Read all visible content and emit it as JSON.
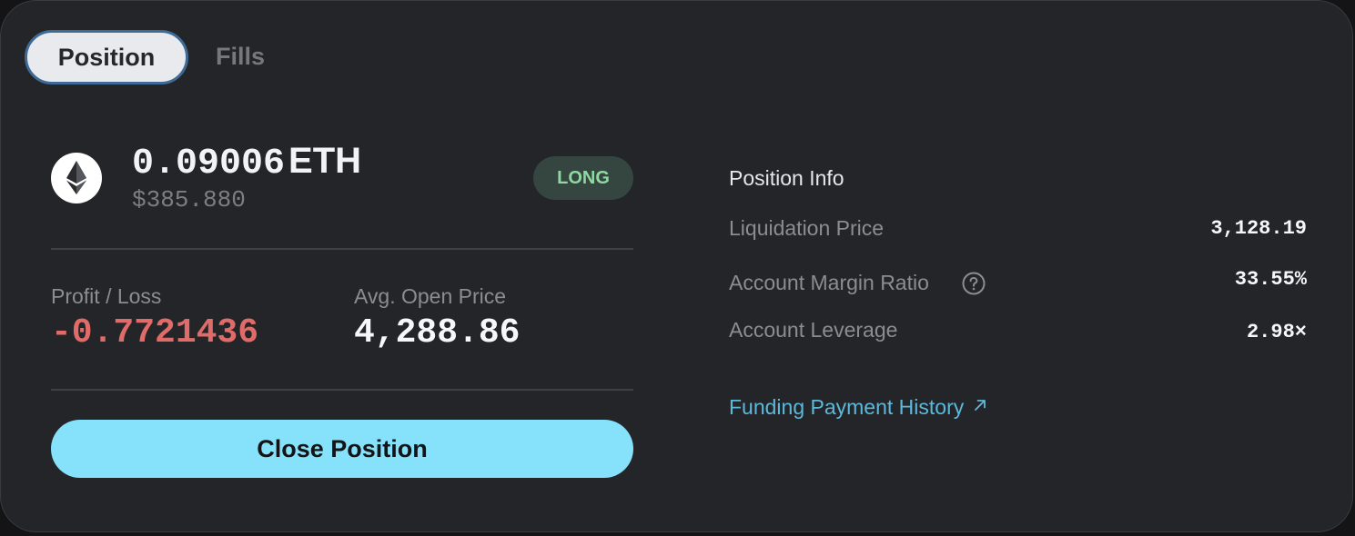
{
  "tabs": {
    "position_label": "Position",
    "fills_label": "Fills",
    "active": "Position"
  },
  "position": {
    "asset_icon": "ethereum-icon",
    "amount": "0.09006",
    "unit": "ETH",
    "usd_value": "$385.880",
    "side": "LONG",
    "pnl_label": "Profit / Loss",
    "pnl_value": "-0.7721436",
    "avg_open_label": "Avg. Open Price",
    "avg_open_value": "4,288.86",
    "close_button": "Close Position"
  },
  "info": {
    "title": "Position Info",
    "liquidation_label": "Liquidation Price",
    "liquidation_value": "3,128.19",
    "margin_ratio_label": "Account Margin Ratio",
    "margin_ratio_value": "33.55%",
    "leverage_label": "Account Leverage",
    "leverage_value": "2.98×",
    "funding_link": "Funding Payment History"
  },
  "colors": {
    "panel_bg": "#242528",
    "accent_button": "#86e2fb",
    "loss_red": "#e06b68",
    "long_green": "#8fd8a2",
    "link_blue": "#5cb9dc"
  }
}
